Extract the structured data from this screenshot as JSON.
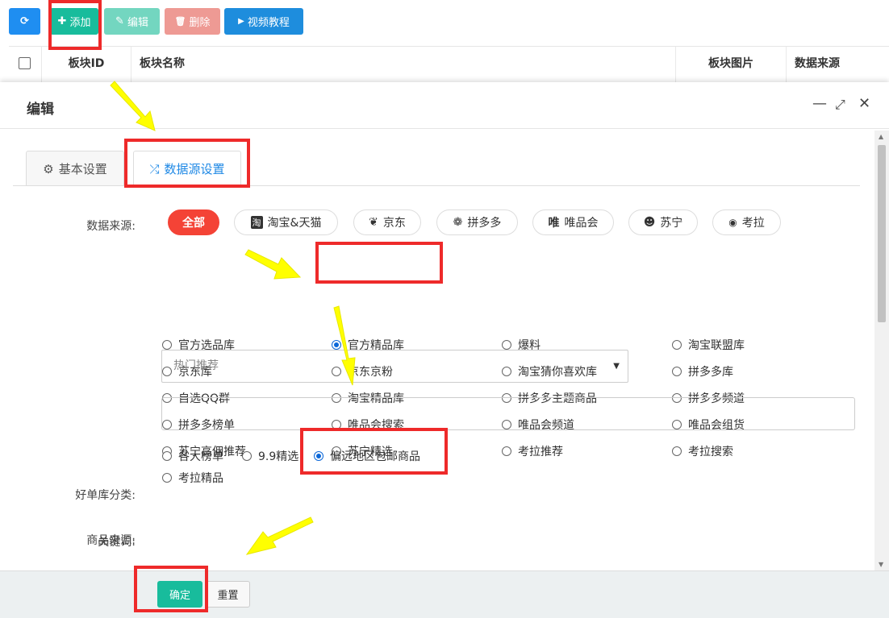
{
  "toolbar": {
    "refresh_icon": "⟳",
    "add_icon": "✚",
    "add_label": "添加",
    "edit_icon": "✎",
    "edit_label": "编辑",
    "delete_icon": "🗑",
    "delete_label": "删除",
    "video_icon": "▶",
    "video_label": "视频教程"
  },
  "table": {
    "columns": [
      "板块ID",
      "板块名称",
      "板块图片",
      "数据来源"
    ]
  },
  "modal": {
    "title": "编辑",
    "tabs": [
      {
        "label": "基本设置",
        "icon": "⚙"
      },
      {
        "label": "数据源设置",
        "icon": "⤮"
      }
    ],
    "data_source_label": "数据来源:",
    "platforms": [
      {
        "label": "全部",
        "icon": ""
      },
      {
        "label": "淘宝&天猫",
        "icon": "淘"
      },
      {
        "label": "京东",
        "icon": "❦"
      },
      {
        "label": "拼多多",
        "icon": "❁"
      },
      {
        "label": "唯品会",
        "icon": "唯"
      },
      {
        "label": "苏宁",
        "icon": "☻"
      },
      {
        "label": "考拉",
        "icon": "◉"
      }
    ],
    "sources": [
      [
        "官方选品库",
        "官方精品库",
        "爆料",
        "淘宝联盟库"
      ],
      [
        "京东库",
        "京东京粉",
        "淘宝猜你喜欢库",
        "拼多多库"
      ],
      [
        "自选QQ群",
        "淘宝精品库",
        "拼多多主题商品",
        "拼多多频道"
      ],
      [
        "拼多多榜单",
        "唯品会搜索",
        "唯品会频道",
        "唯品会组货"
      ],
      [
        "苏宁高佣推荐",
        "苏宁精选",
        "考拉推荐",
        "考拉搜索"
      ],
      [
        "考拉精品"
      ]
    ],
    "selected_source": "官方精品库",
    "goods_source_label": "商品来源:",
    "goods_sources": [
      "各大榜单",
      "9.9精选",
      "偏远地区包邮商品"
    ],
    "selected_goods_source": "偏远地区包邮商品",
    "category_label": "好单库分类:",
    "category_value": "热门推荐",
    "keyword_label": "关键词:",
    "keyword_value": "",
    "ok_label": "确定",
    "reset_label": "重置"
  },
  "colors": {
    "primary": "#18bc9c",
    "blue": "#1e88e5",
    "red": "#f44336",
    "annotation": "#ee2a2a",
    "arrow": "#ffff00"
  }
}
